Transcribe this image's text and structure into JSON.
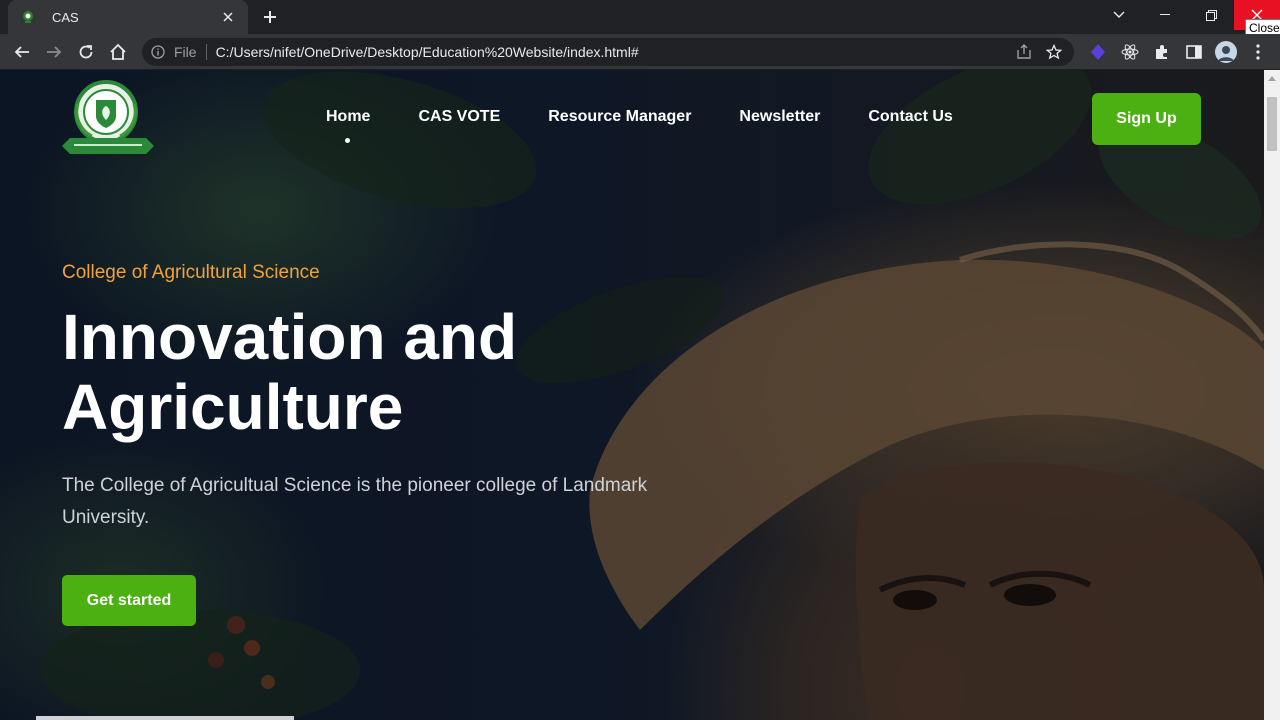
{
  "browser": {
    "tab_title": "CAS",
    "address_scheme": "File",
    "address_url": "C:/Users/nifet/OneDrive/Desktop/Education%20Website/index.html#",
    "close_tooltip": "Close",
    "icons": [
      "back-arrow-icon",
      "forward-arrow-icon",
      "reload-icon",
      "home-icon",
      "info-icon",
      "share-icon",
      "star-icon",
      "extension-icon",
      "react-icon",
      "puzzle-icon",
      "side-panel-icon",
      "avatar",
      "more-vert-icon"
    ]
  },
  "site": {
    "nav": [
      {
        "label": "Home"
      },
      {
        "label": "CAS VOTE"
      },
      {
        "label": "Resource Manager"
      },
      {
        "label": "Newsletter"
      },
      {
        "label": "Contact Us"
      }
    ],
    "signup_label": "Sign Up",
    "hero": {
      "eyebrow": "College of Agricultural Science",
      "headline_line1": "Innovation and",
      "headline_line2": "Agriculture",
      "lead": "The College of Agricultual Science is the pioneer college of Landmark University.",
      "cta": "Get started"
    },
    "colors": {
      "accent_green": "#4caf12",
      "eyebrow_orange": "#f2a23b"
    }
  }
}
